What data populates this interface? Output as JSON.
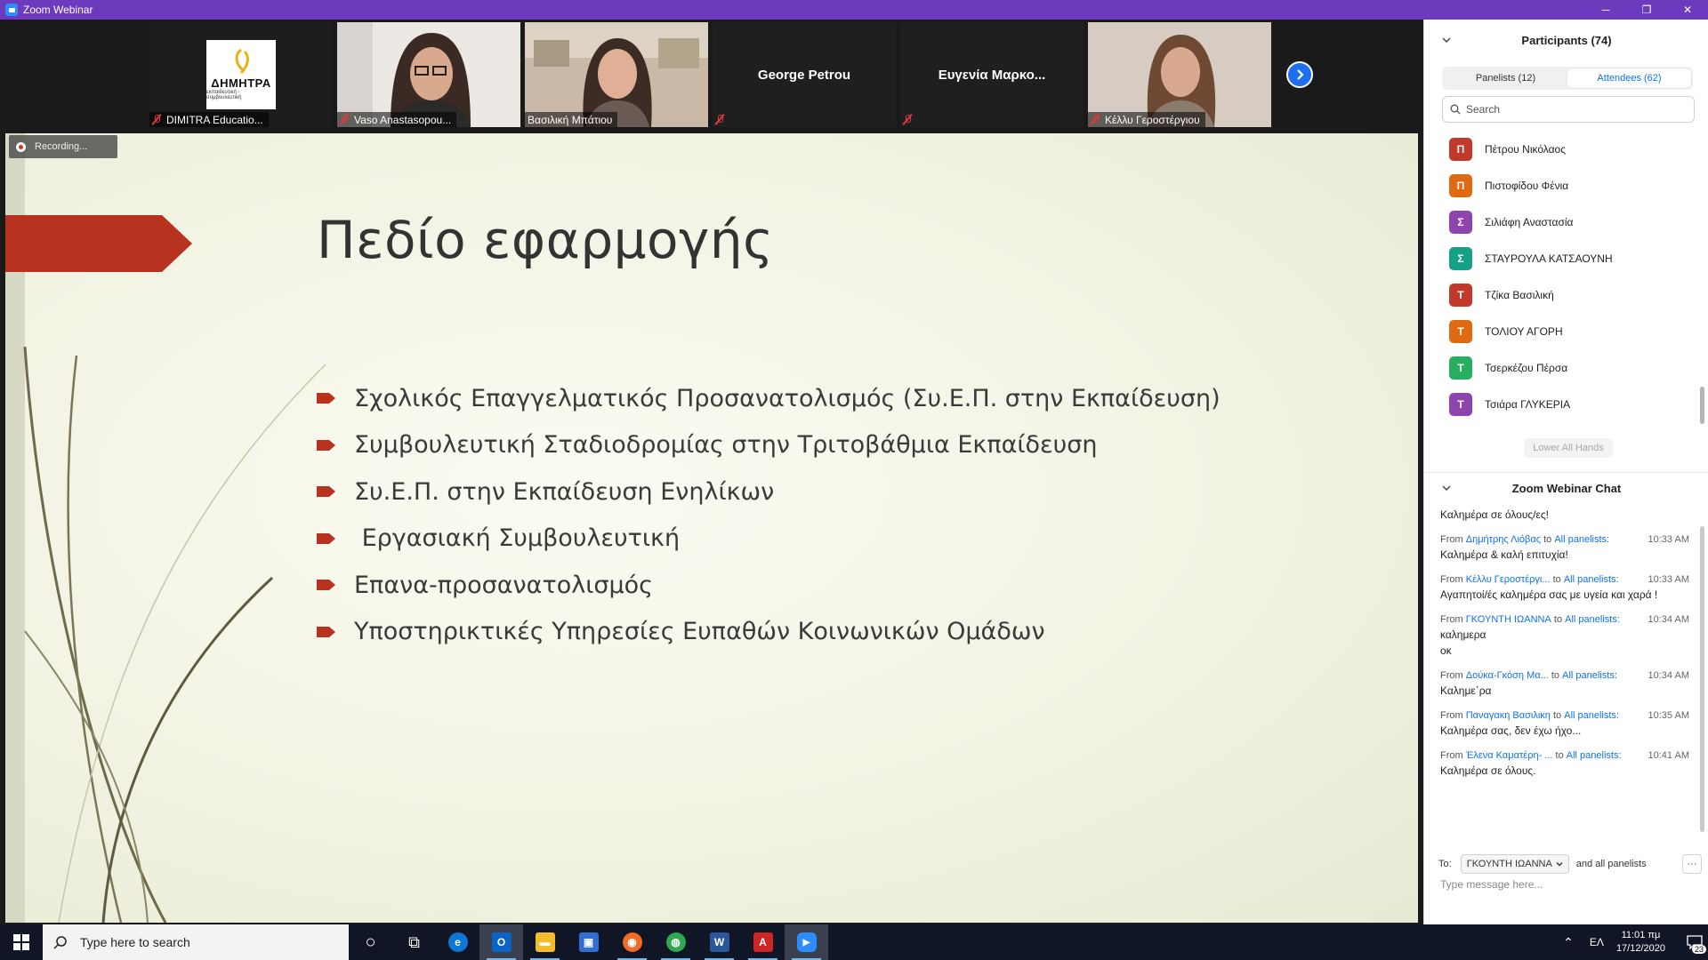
{
  "window": {
    "title": "Zoom Webinar",
    "controls": {
      "minimize": "─",
      "restore": "❐",
      "close": "✕"
    }
  },
  "video_strip": {
    "tiles": [
      {
        "name": "DIMITRA Educatio...",
        "kind": "logo",
        "logo_text": "ΔΗΜΗΤΡΑ",
        "logo_sub": "εκπαιδευτική - συμβουλευτική",
        "muted": true
      },
      {
        "name": "Vaso Anastasopou...",
        "kind": "video",
        "muted": true
      },
      {
        "name": "Βασιλική Μπάτιου",
        "kind": "video",
        "muted": false,
        "active_speaker": true
      },
      {
        "name": "George Petrou",
        "kind": "name-only",
        "muted": true
      },
      {
        "name": "Ευγενία Μαρκο...",
        "kind": "name-only",
        "muted": true
      },
      {
        "name": "Κέλλυ Γεροστέργιου",
        "kind": "video",
        "muted": true
      }
    ],
    "next_icon": "chevron-right-icon"
  },
  "share": {
    "recording_label": "Recording...",
    "slide": {
      "title": "Πεδίο εφαρμογής",
      "bullets": [
        "Σχολικός Επαγγελματικός Προσανατολισμός (Συ.Ε.Π. στην Εκπαίδευση)",
        "Συμβουλευτική Σταδιοδρομίας στην Τριτοβάθμια Εκπαίδευση",
        "Συ.Ε.Π. στην Εκπαίδευση Ενηλίκων",
        " Εργασιακή Συμβουλευτική",
        "Επανα-προσανατολισμός",
        "Υποστηρικτικές Υπηρεσίες Ευπαθών Κοινωνικών Ομάδων"
      ],
      "accent_color": "#b83220"
    }
  },
  "participants": {
    "header": "Participants (74)",
    "tabs": [
      {
        "label": "Panelists (12)",
        "selected": false
      },
      {
        "label": "Attendees (62)",
        "selected": true
      }
    ],
    "search_placeholder": "Search",
    "list": [
      {
        "initial": "Π",
        "name": "Πέτρου Νικόλαος",
        "color": "#c0392b"
      },
      {
        "initial": "Π",
        "name": "Πιστοφίδου Φένια",
        "color": "#e06a12"
      },
      {
        "initial": "Σ",
        "name": "Σιλιάφη Αναστασία",
        "color": "#8e44ad"
      },
      {
        "initial": "Σ",
        "name": "ΣΤΑΥΡΟΥΛΑ ΚΑΤΣΑΟΥΝΗ",
        "color": "#16a085"
      },
      {
        "initial": "Τ",
        "name": "Τζίκα Βασιλική",
        "color": "#c0392b"
      },
      {
        "initial": "Τ",
        "name": "ΤΟΛΙΟΥ ΑΓΟΡΗ",
        "color": "#e06a12"
      },
      {
        "initial": "Τ",
        "name": "Τσερκέζου Πέρσα",
        "color": "#27ae60"
      },
      {
        "initial": "Τ",
        "name": "Τσιάρα ΓΛΥΚΕΡΙΑ",
        "color": "#8e44ad"
      }
    ],
    "lower_hands_label": "Lower All Hands"
  },
  "chat": {
    "header": "Zoom Webinar Chat",
    "first_message": "Καλημέρα σε όλους/ες!",
    "messages": [
      {
        "from_label": "From",
        "sender": "Δημήτρης Λιόβας",
        "to_label": "to",
        "recipient": "All panelists:",
        "time": "10:33 AM",
        "text": "Καλημέρα & καλή επιτυχία!"
      },
      {
        "from_label": "From",
        "sender": "Κέλλυ Γεροστέργι...",
        "to_label": "to",
        "recipient": "All panelists:",
        "time": "10:33 AM",
        "text": "Αγαπητοί/ές καλημέρα σας με υγεία και χαρά !"
      },
      {
        "from_label": "From",
        "sender": "ΓΚΟΥΝΤΗ ΙΩΑΝΝΑ",
        "to_label": "to",
        "recipient": "All panelists:",
        "time": "10:34 AM",
        "text": "καλημερα\nοκ"
      },
      {
        "from_label": "From",
        "sender": "Δούκα-Γκόση Μα...",
        "to_label": "to",
        "recipient": "All panelists:",
        "time": "10:34 AM",
        "text": "Καλημε΄ρα"
      },
      {
        "from_label": "From",
        "sender": "Παναγακη Βασιλικη",
        "to_label": "to",
        "recipient": "All panelists:",
        "time": "10:35 AM",
        "text": "Καλημέρα σας, δεν έχω ήχο..."
      },
      {
        "from_label": "From",
        "sender": "Έλενα Καματέρη- ...",
        "to_label": "to",
        "recipient": "All panelists:",
        "time": "10:41 AM",
        "text": "Καλημέρα σε όλους."
      }
    ],
    "to_label": "To:",
    "to_value": "ΓΚΟΥΝΤΗ ΙΩΑΝΝΑ",
    "and_all": "and all panelists",
    "more_label": "···",
    "input_placeholder": "Type message here..."
  },
  "taskbar": {
    "search_placeholder": "Type here to search",
    "apps": [
      {
        "name": "cortana-icon",
        "glyph": "○"
      },
      {
        "name": "task-view-icon",
        "glyph": "⧉"
      },
      {
        "name": "edge-icon",
        "glyph": "e",
        "color": "#0f78d4"
      },
      {
        "name": "outlook-icon",
        "glyph": "O",
        "color": "#0a64c8",
        "active": true
      },
      {
        "name": "file-explorer-icon",
        "glyph": "▬",
        "color": "#f2bd2c"
      },
      {
        "name": "store-icon",
        "glyph": "▣",
        "color": "#2f6ed3"
      },
      {
        "name": "firefox-icon",
        "glyph": "◉",
        "color": "#f06a28"
      },
      {
        "name": "chrome-icon",
        "glyph": "◍",
        "color": "#2fa84f"
      },
      {
        "name": "word-icon",
        "glyph": "W",
        "color": "#2b579a"
      },
      {
        "name": "acrobat-icon",
        "glyph": "A",
        "color": "#d02525"
      },
      {
        "name": "zoom-icon",
        "glyph": "▶",
        "color": "#2d8cff",
        "active": true
      }
    ],
    "tray_chevron": "⌃",
    "lang": "ΕΛ",
    "time": "11:01 πμ",
    "date": "17/12/2020",
    "notification_count": "23"
  }
}
